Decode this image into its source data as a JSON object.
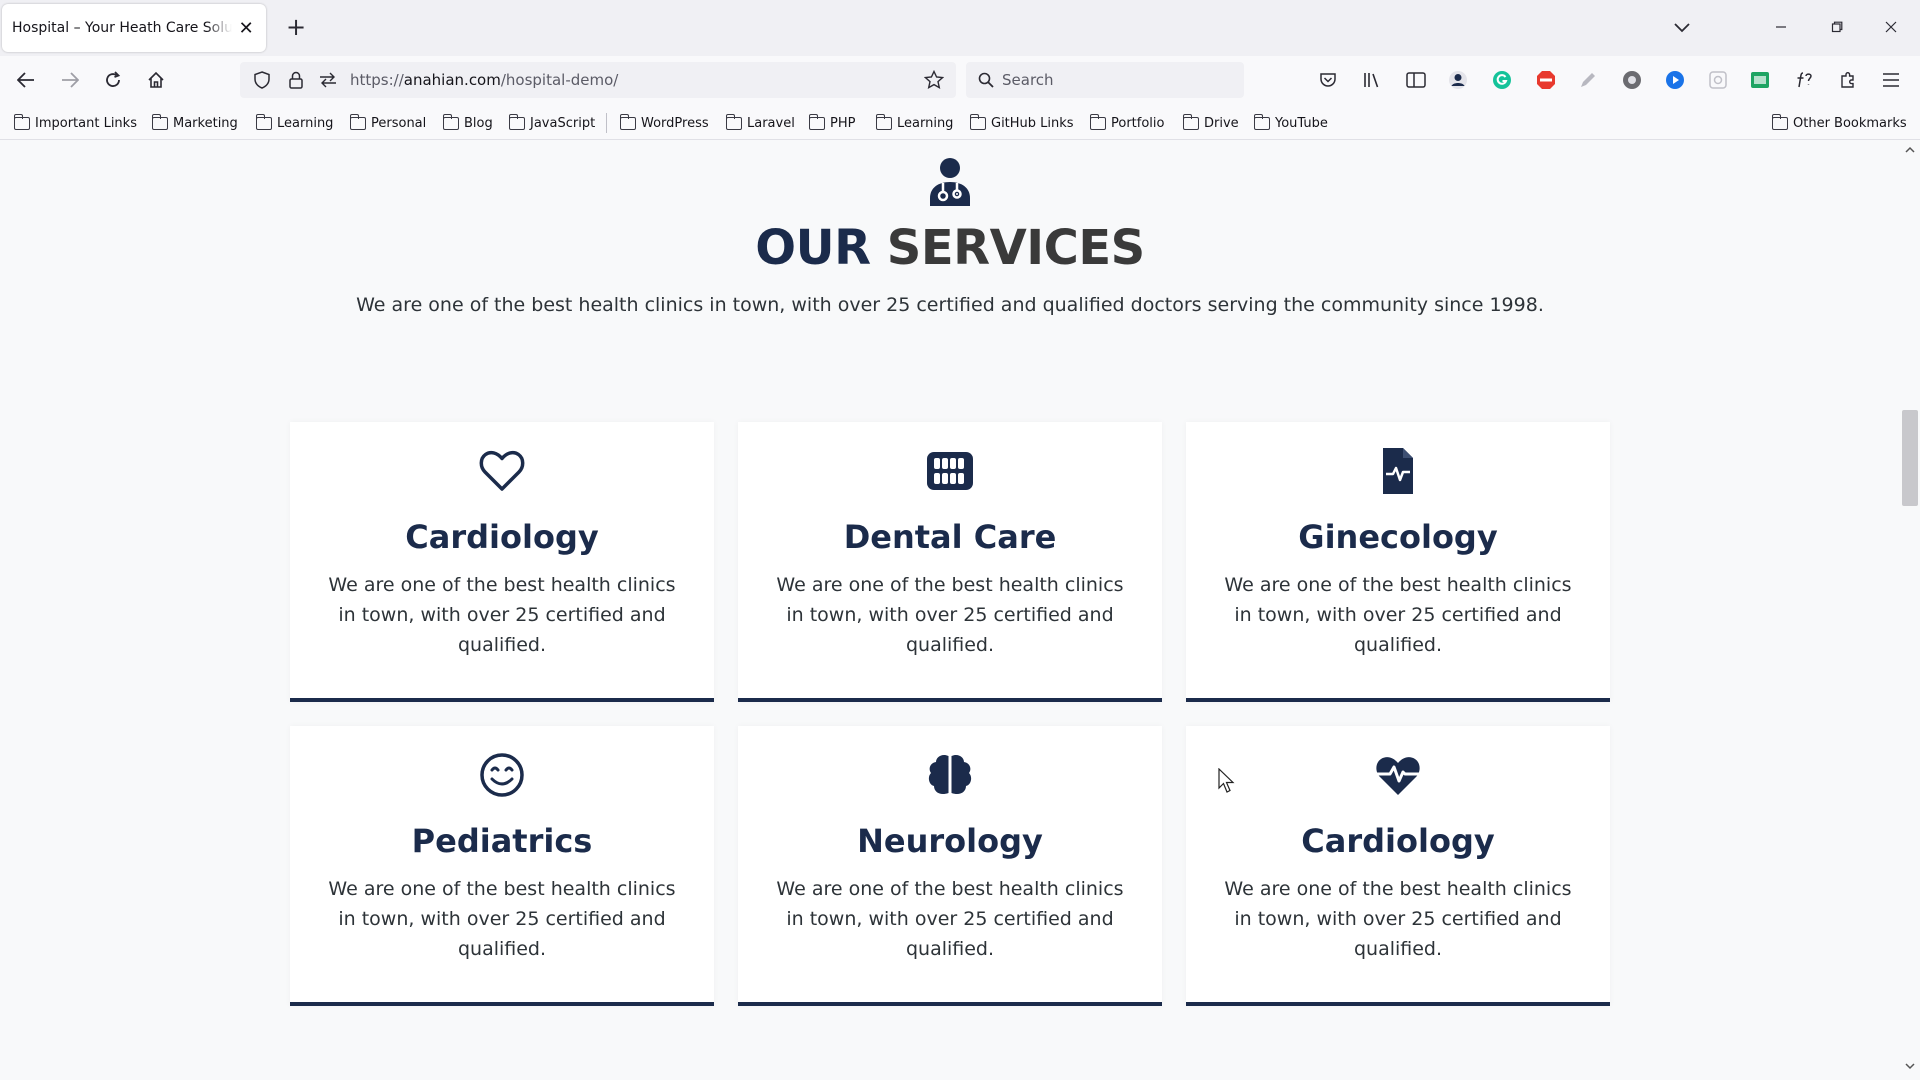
{
  "browser": {
    "tab_title": "Hospital – Your Heath Care Solution",
    "tab_close": "✕",
    "new_tab": "+",
    "url_prefix": "https://",
    "url_domain": "anahian.com",
    "url_path": "/hospital-demo/",
    "search_placeholder": "Search",
    "bookmarks": [
      "Important Links",
      "Marketing",
      "Learning",
      "Personal",
      "Blog",
      "JavaScript",
      "WordPress",
      "Laravel",
      "PHP",
      "Learning",
      "GitHub Links",
      "Portfolio",
      "Drive",
      "YouTube"
    ],
    "other_bookmarks": "Other Bookmarks"
  },
  "section": {
    "icon": "doctor-icon",
    "title_part1": "OUR",
    "title_part2": "SERVICES",
    "subtitle": "We are one of the best health clinics in town, with over 25 certified and qualified doctors serving the community since 1998."
  },
  "services": [
    {
      "icon": "heart-outline-icon",
      "title": "Cardiology",
      "text": "We are one of the best health clinics in town, with over 25 certified and qualified."
    },
    {
      "icon": "teeth-icon",
      "title": "Dental Care",
      "text": "We are one of the best health clinics in town, with over 25 certified and qualified."
    },
    {
      "icon": "medical-file-icon",
      "title": "Ginecology",
      "text": "We are one of the best health clinics in town, with over 25 certified and qualified."
    },
    {
      "icon": "smile-icon",
      "title": "Pediatrics",
      "text": "We are one of the best health clinics in town, with over 25 certified and qualified."
    },
    {
      "icon": "brain-icon",
      "title": "Neurology",
      "text": "We are one of the best health clinics in town, with over 25 certified and qualified."
    },
    {
      "icon": "heart-pulse-icon",
      "title": "Cardiology",
      "text": "We are one of the best health clinics in town, with over 25 certified and qualified."
    }
  ],
  "colors": {
    "navy": "#1b2b4b",
    "dark_gray": "#3a3a3a",
    "page_bg": "#f8f9fa",
    "card_bg": "#ffffff"
  }
}
